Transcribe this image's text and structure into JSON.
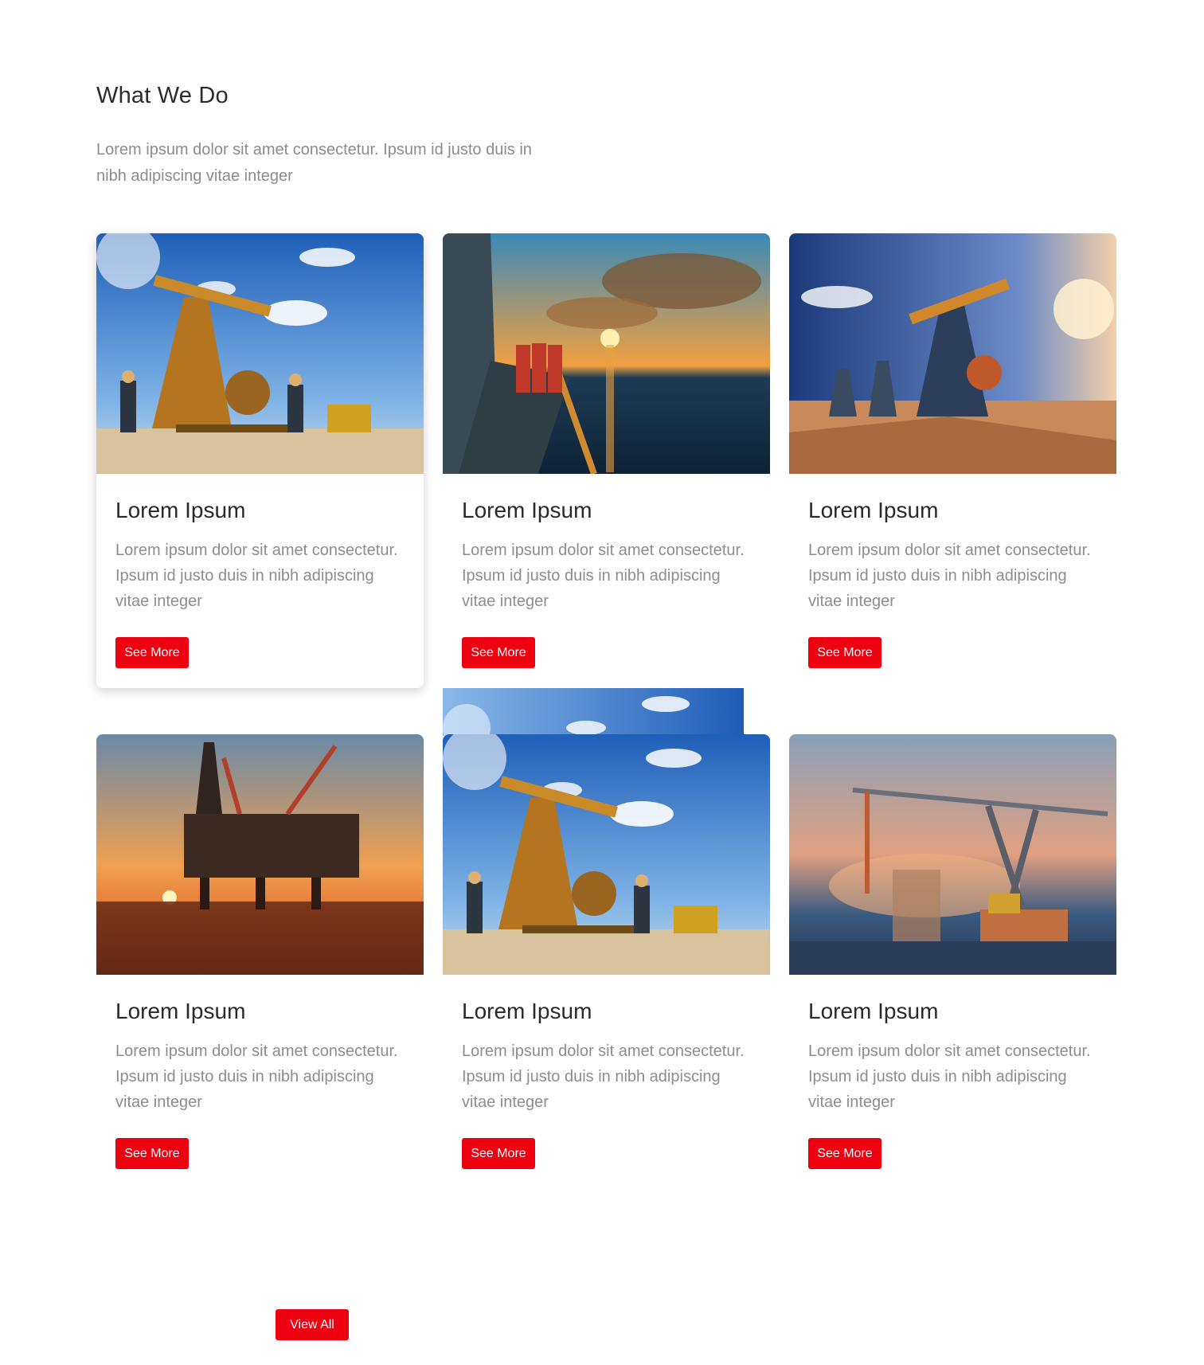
{
  "section": {
    "title": "What We Do",
    "description": "Lorem ipsum dolor sit amet consectetur. Ipsum id justo duis in nibh adipiscing vitae integer"
  },
  "cards": [
    {
      "image": "oil-pumpjack-workers-photo",
      "title": "Lorem Ipsum",
      "text": "Lorem ipsum dolor sit amet consectetur. Ipsum id justo duis in nibh adipiscing vitae integer",
      "button": "See More"
    },
    {
      "image": "offshore-platform-sunset-workers-photo",
      "title": "Lorem Ipsum",
      "text": "Lorem ipsum dolor sit amet consectetur. Ipsum id justo duis in nibh adipiscing vitae integer",
      "button": "See More"
    },
    {
      "image": "pumpjack-field-sunset-photo",
      "title": "Lorem Ipsum",
      "text": "Lorem ipsum dolor sit amet consectetur. Ipsum id justo duis in nibh adipiscing vitae integer",
      "button": "See More"
    },
    {
      "image": "offshore-rig-sunset-photo",
      "title": "Lorem Ipsum",
      "text": "Lorem ipsum dolor sit amet consectetur. Ipsum id justo duis in nibh adipiscing vitae integer",
      "button": "See More"
    },
    {
      "image": "oil-pumpjack-workers-photo",
      "title": "Lorem Ipsum",
      "text": "Lorem ipsum dolor sit amet consectetur. Ipsum id justo duis in nibh adipiscing vitae integer",
      "button": "See More"
    },
    {
      "image": "harbor-crane-photo",
      "title": "Lorem Ipsum",
      "text": "Lorem ipsum dolor sit amet consectetur. Ipsum id justo duis in nibh adipiscing vitae integer",
      "button": "See More"
    }
  ],
  "footer": {
    "view_all_label": "View All"
  },
  "colors": {
    "accent": "#ee0011",
    "title_text": "#2b2b2b",
    "muted_text": "#8c8c8c"
  }
}
